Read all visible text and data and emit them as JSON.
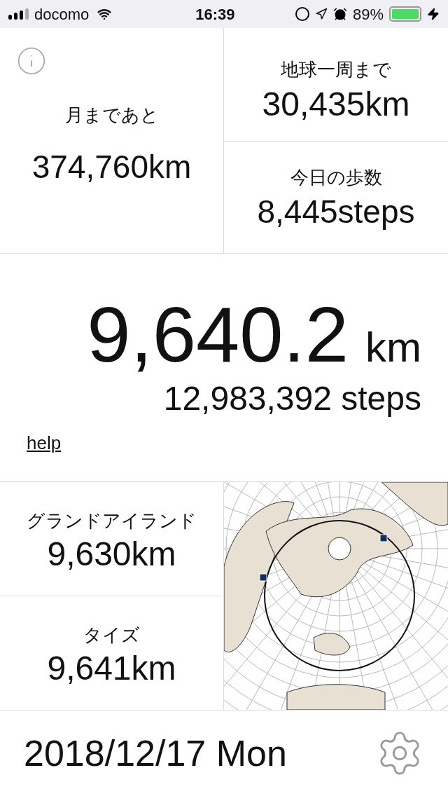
{
  "status_bar": {
    "carrier": "docomo",
    "time": "16:39",
    "battery": "89%"
  },
  "moon": {
    "label": "月まであと",
    "value": "374,760km"
  },
  "earth_lap": {
    "label": "地球一周まで",
    "value": "30,435km"
  },
  "today_steps": {
    "label": "今日の歩数",
    "value": "8,445steps"
  },
  "total": {
    "distance": "9,640.2",
    "unit": "km",
    "steps": "12,983,392 steps",
    "help": "help"
  },
  "places": [
    {
      "name": "グランドアイランド",
      "distance": "9,630km"
    },
    {
      "name": "タイズ",
      "distance": "9,641km"
    }
  ],
  "date": "2018/12/17 Mon"
}
